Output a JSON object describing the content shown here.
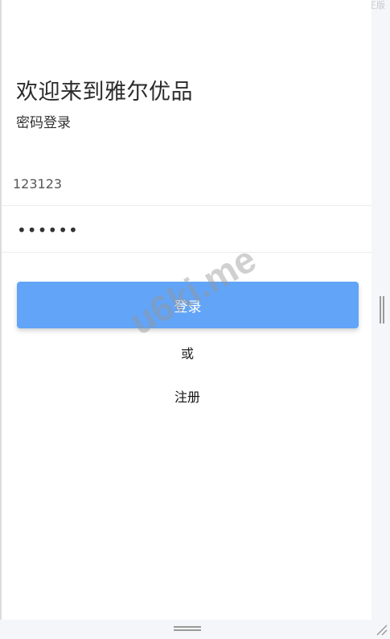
{
  "corner_label": "正版",
  "login": {
    "title": "欢迎来到雅尔优品",
    "subtitle": "密码登录",
    "username_value": "123123",
    "password_value": "••••••",
    "login_label": "登录",
    "or_label": "或",
    "register_label": "注册"
  },
  "watermark": "u6ki.me",
  "colors": {
    "primary_button": "#62a4f7",
    "background": "#ffffff",
    "outer_background": "#f5f6fa"
  }
}
